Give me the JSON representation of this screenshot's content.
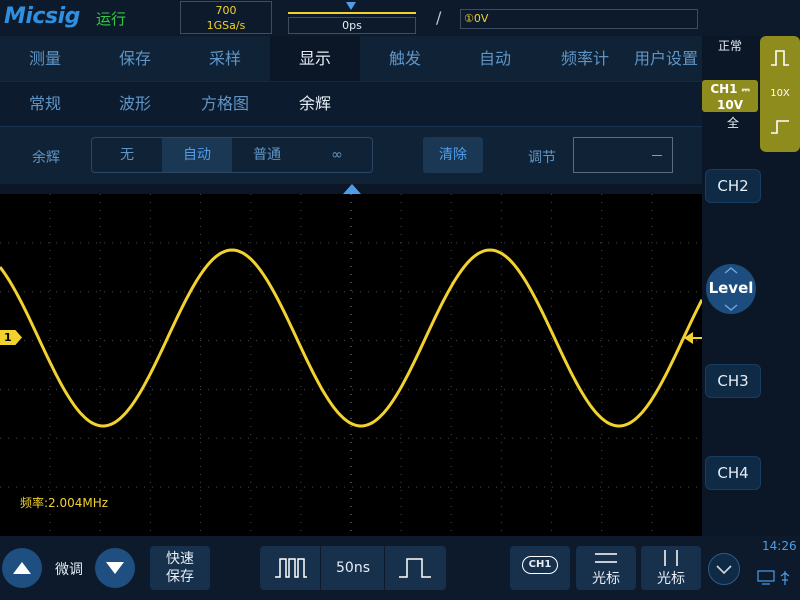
{
  "brand": "Micsig",
  "run_status": "运行",
  "memory": {
    "depth": "700",
    "sample_rate": "1GSa/s"
  },
  "timebase_offset": "0ps",
  "trigger": {
    "edge": "/",
    "info": "①0V"
  },
  "menu_main": [
    "测量",
    "保存",
    "采样",
    "显示",
    "触发",
    "自动",
    "频率计",
    "用户设置"
  ],
  "menu_sub": [
    "常规",
    "波形",
    "方格图",
    "余辉"
  ],
  "persistence": {
    "label": "余辉",
    "options": [
      "无",
      "自动",
      "普通",
      "∞"
    ],
    "selected": "自动",
    "clear_label": "清除",
    "adjust_label": "调节",
    "adjust_value": "—"
  },
  "channel_marker": "1",
  "frequency_readout": "频率:2.004MHz",
  "right_panel": {
    "trigger_mode": "正常",
    "ch1_label": "CH1",
    "ch1_coupling": "⎓",
    "ch1_scale": "10V",
    "ch1_bandwidth": "全",
    "probe": "10X",
    "level_label": "Level",
    "channels": [
      "CH2",
      "CH3",
      "CH4"
    ]
  },
  "bottom": {
    "fine_label": "微调",
    "quick_save": [
      "快速",
      "保存"
    ],
    "timebase": "50ns",
    "ch_select": "CH1",
    "cursor_h": "光标",
    "cursor_v": "光标",
    "clock": "14:26"
  },
  "colors": {
    "ch1": "#f2d22e",
    "accent": "#4f9de8",
    "background": "#0b1726"
  }
}
